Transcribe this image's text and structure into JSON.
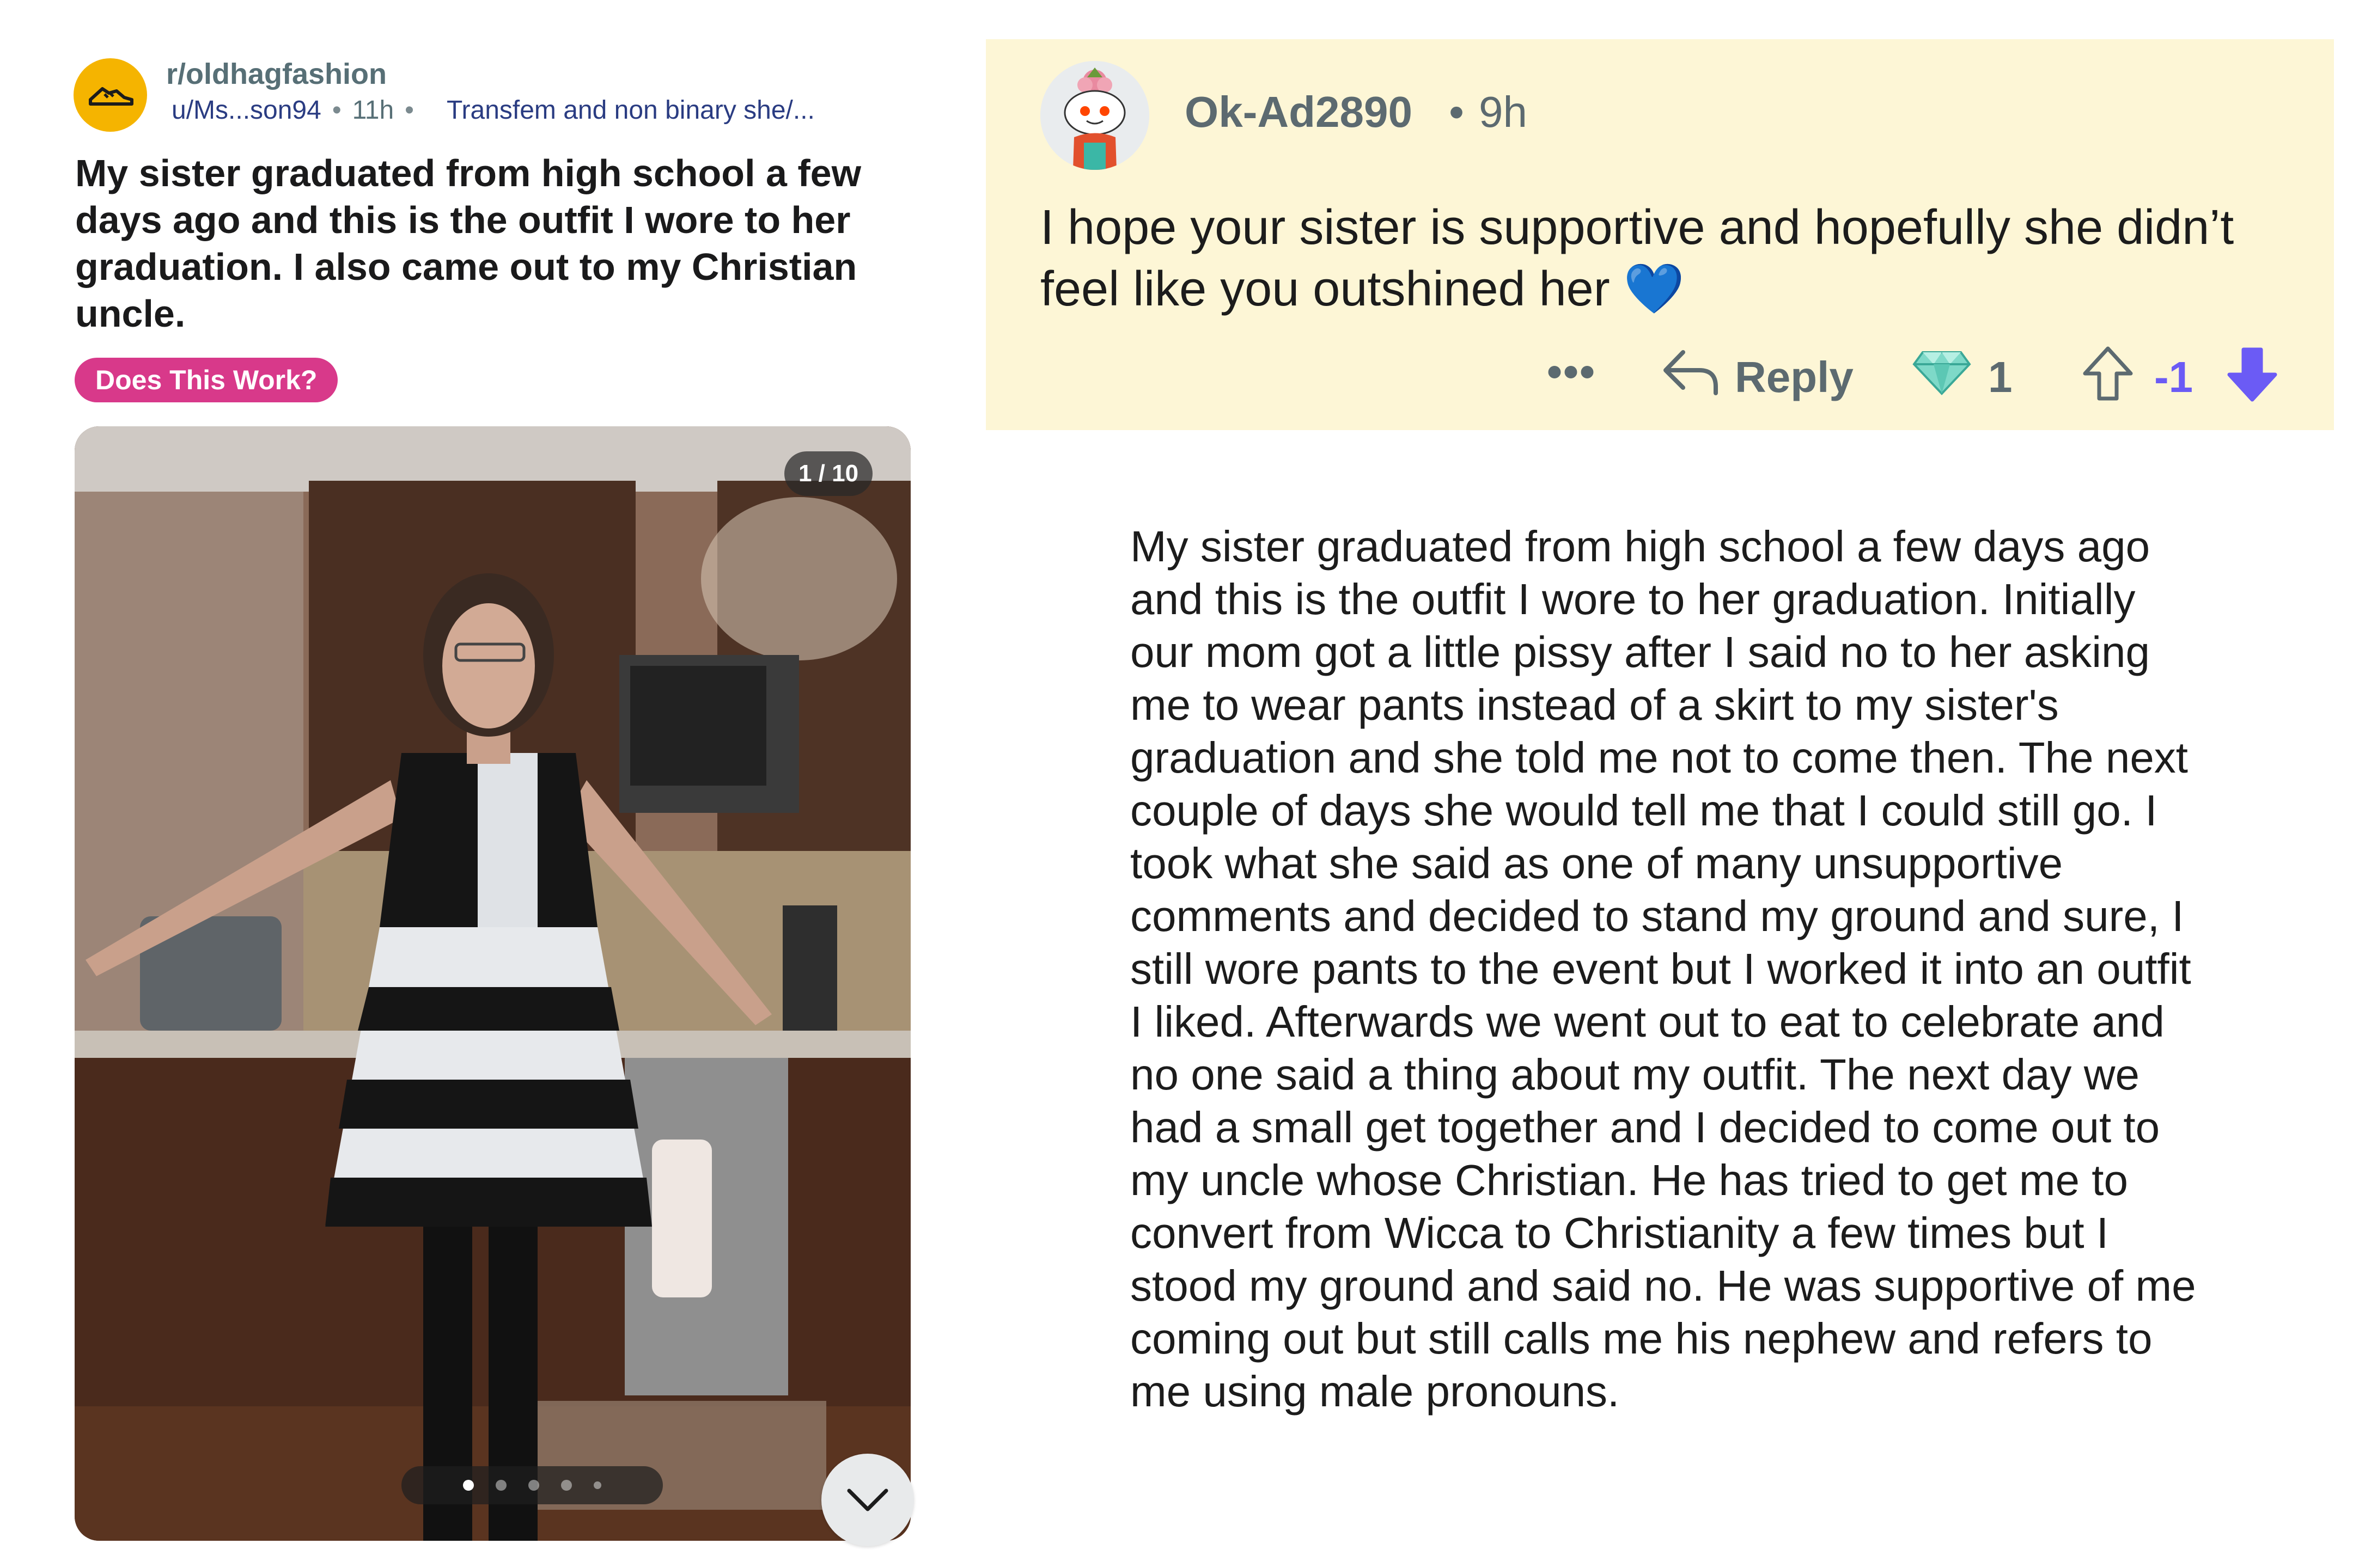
{
  "post": {
    "subreddit": "r/oldhagfashion",
    "user": "u/Ms...son94",
    "time": "11h",
    "user_flair": "Transfem and non binary  she/...",
    "title": "My sister graduated from high school a few days ago and this is the outfit I wore to her graduation. I also came out to my Christian uncle.",
    "flair": "Does This Work?",
    "image_counter": "1 / 10",
    "carousel_total": 10,
    "carousel_index": 1
  },
  "comment": {
    "author": "Ok-Ad2890",
    "separator": "•",
    "time": "9h",
    "body": "I hope your sister is supportive and hopefully she didn’t feel like you outshined her 💙",
    "more": "•••",
    "reply_label": "Reply",
    "award_count": "1",
    "score": "-1",
    "score_color": "#6b5bf5"
  },
  "body_text": "My sister graduated from high school a few days ago and this is the outfit I wore to her graduation. Initially our mom got a little pissy after I said no to her asking me to wear pants instead of a skirt to my sister's graduation and she told me not to come then. The next couple of days she would tell me that I could still go. I took what she said as one of many unsupportive comments and decided to stand my ground and sure, I still wore pants to the event but I worked it into an outfit I liked. Afterwards we went out to eat to celebrate and no one said a thing about my outfit. The next day we had a small get together and I decided to come out to my uncle whose Christian. He has tried to get me to convert from Wicca to Christianity a few times but I stood my ground and said no. He was supportive of me coming out but still calls me his nephew and refers to me using male pronouns.",
  "icons": {
    "subreddit_avatar": "shoe-icon",
    "comment_avatar": "snoo-avatar",
    "expand": "chevron-down-icon",
    "reply": "reply-arrow-icon",
    "award": "diamond-icon",
    "upvote": "upvote-arrow-icon",
    "downvote": "downvote-arrow-icon"
  },
  "colors": {
    "accent_yellow": "#f5b400",
    "flair_pink": "#d8398a",
    "comment_bg": "#fdf6d6",
    "link_blue": "#2a3c82"
  }
}
